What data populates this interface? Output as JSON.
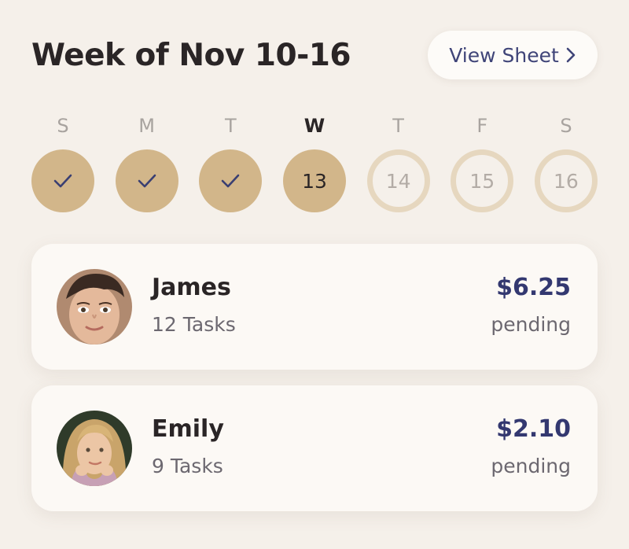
{
  "header": {
    "title": "Week of Nov 10-16",
    "view_sheet_label": "View Sheet",
    "view_sheet_icon": "chevron-right-icon"
  },
  "week": {
    "days": [
      {
        "letter": "S",
        "date": "",
        "state": "done"
      },
      {
        "letter": "M",
        "date": "",
        "state": "done"
      },
      {
        "letter": "T",
        "date": "",
        "state": "done"
      },
      {
        "letter": "W",
        "date": "13",
        "state": "current"
      },
      {
        "letter": "T",
        "date": "14",
        "state": "future"
      },
      {
        "letter": "F",
        "date": "15",
        "state": "future"
      },
      {
        "letter": "S",
        "date": "16",
        "state": "future"
      }
    ],
    "check_icon": "checkmark-icon"
  },
  "children": [
    {
      "name": "James",
      "tasks": "12 Tasks",
      "amount": "$6.25",
      "status": "pending"
    },
    {
      "name": "Emily",
      "tasks": "9 Tasks",
      "amount": "$2.10",
      "status": "pending"
    }
  ],
  "colors": {
    "background": "#f5f0ea",
    "accent_tan": "#d2b68a",
    "accent_tan_light": "#e6d7bf",
    "navy": "#333870",
    "card": "#fcf9f5"
  }
}
